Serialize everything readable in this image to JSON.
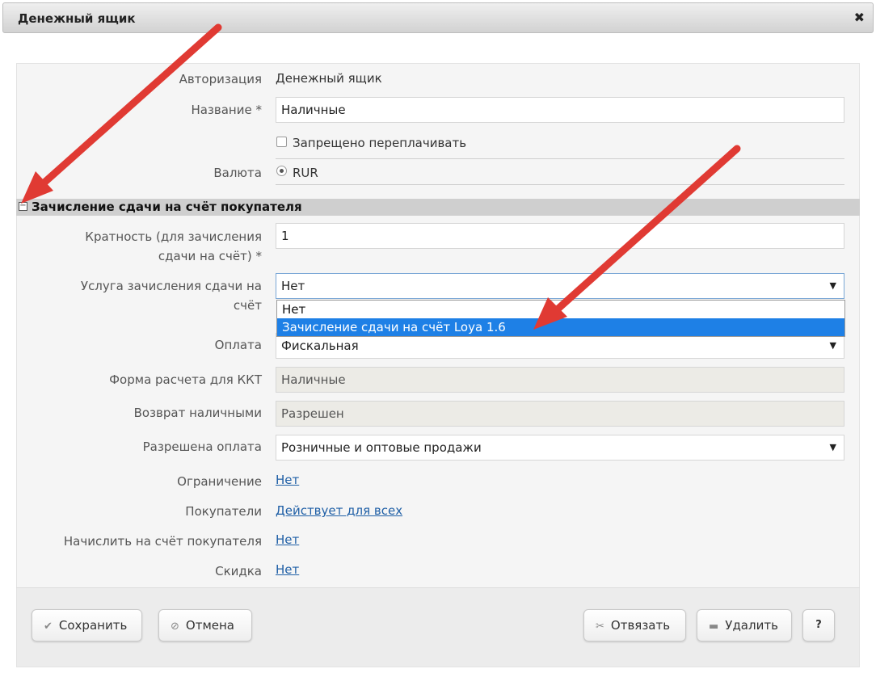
{
  "window": {
    "title": "Денежный ящик",
    "close_glyph": "✖"
  },
  "form": {
    "authorization_label": "Авторизация",
    "authorization_value": "Денежный ящик",
    "name_label": "Название *",
    "name_value": "Наличные",
    "no_overpay_label": "Запрещено переплачивать",
    "currency_label": "Валюта",
    "currency_value": "RUR",
    "section_title": "Зачисление сдачи на счёт покупателя",
    "multiplicity_label_1": "Кратность (для зачисления",
    "multiplicity_label_2": "сдачи на счёт) *",
    "multiplicity_value": "1",
    "change_service_label_1": "Услуга зачисления сдачи на",
    "change_service_label_2": "счёт",
    "change_service_value": "Нет",
    "change_service_options": [
      "Нет",
      "Зачисление сдачи на счёт Loya 1.6"
    ],
    "payment_label": "Оплата",
    "payment_value": "Фискальная",
    "kkt_form_label": "Форма расчета для ККТ",
    "kkt_form_value": "Наличные",
    "cash_return_label": "Возврат наличными",
    "cash_return_value": "Разрешен",
    "allowed_payment_label": "Разрешена оплата",
    "allowed_payment_value": "Розничные и оптовые продажи",
    "restriction_label": "Ограничение",
    "restriction_value": "Нет",
    "buyers_label": "Покупатели",
    "buyers_value": "Действует для всех",
    "credit_account_label": "Начислить на счёт покупателя",
    "credit_account_value": "Нет",
    "discount_label": "Скидка",
    "discount_value": "Нет"
  },
  "buttons": {
    "save": "Сохранить",
    "cancel": "Отмена",
    "unlink": "Отвязать",
    "delete": "Удалить",
    "help": "?"
  },
  "icons": {
    "save": "check-icon",
    "cancel": "ban-icon",
    "unlink": "scissors-icon",
    "delete": "minus-icon"
  },
  "colors": {
    "accent_selected": "#1e80e6",
    "link": "#1f5fa6",
    "annotation_arrow": "#e03a33"
  }
}
